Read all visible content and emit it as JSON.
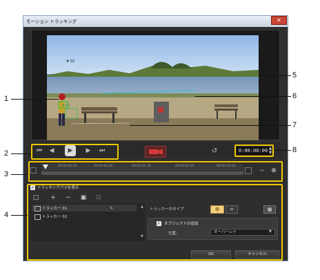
{
  "window": {
    "title": "モーション トラッキング",
    "close_glyph": "✕"
  },
  "video": {
    "tag_1": "# 02",
    "tag_2": "# 01"
  },
  "playback": {
    "timecode": "0:00:00:00",
    "start_glyph": "⏮",
    "prev_glyph": "◀",
    "play_glyph": "▶",
    "next_glyph": "▶",
    "end_glyph": "⏭",
    "reset_glyph": "↺"
  },
  "timeline": {
    "ticks": [
      "00:00:00:00",
      "00:00:00:20",
      "00:00:01:10",
      "00:00:02:00",
      "00:00:02:20"
    ],
    "zoom_out_glyph": "−",
    "zoom_in_glyph": "⊕"
  },
  "tracker": {
    "show_path_label": "トラッキングパスを表示",
    "show_path_checked": "✓",
    "tools": [
      "□",
      "+",
      "−",
      "▣",
      "⊡"
    ],
    "rows": [
      "トラッカー 01",
      "トラッカー 02"
    ],
    "type_label": "トラッカーのタイプ",
    "add_object_label": "オブジェクトの追加",
    "add_object_checked": "✓",
    "position_label": "位置:",
    "position_value": "オーバーレイ"
  },
  "buttons": {
    "ok": "OK",
    "cancel": "キャンセル"
  },
  "callouts": [
    "1",
    "2",
    "3",
    "4",
    "5",
    "6",
    "7",
    "8"
  ],
  "colors": {
    "highlight": "#f0c800",
    "record": "#c03030",
    "window_bg": "#2e2e2e"
  }
}
